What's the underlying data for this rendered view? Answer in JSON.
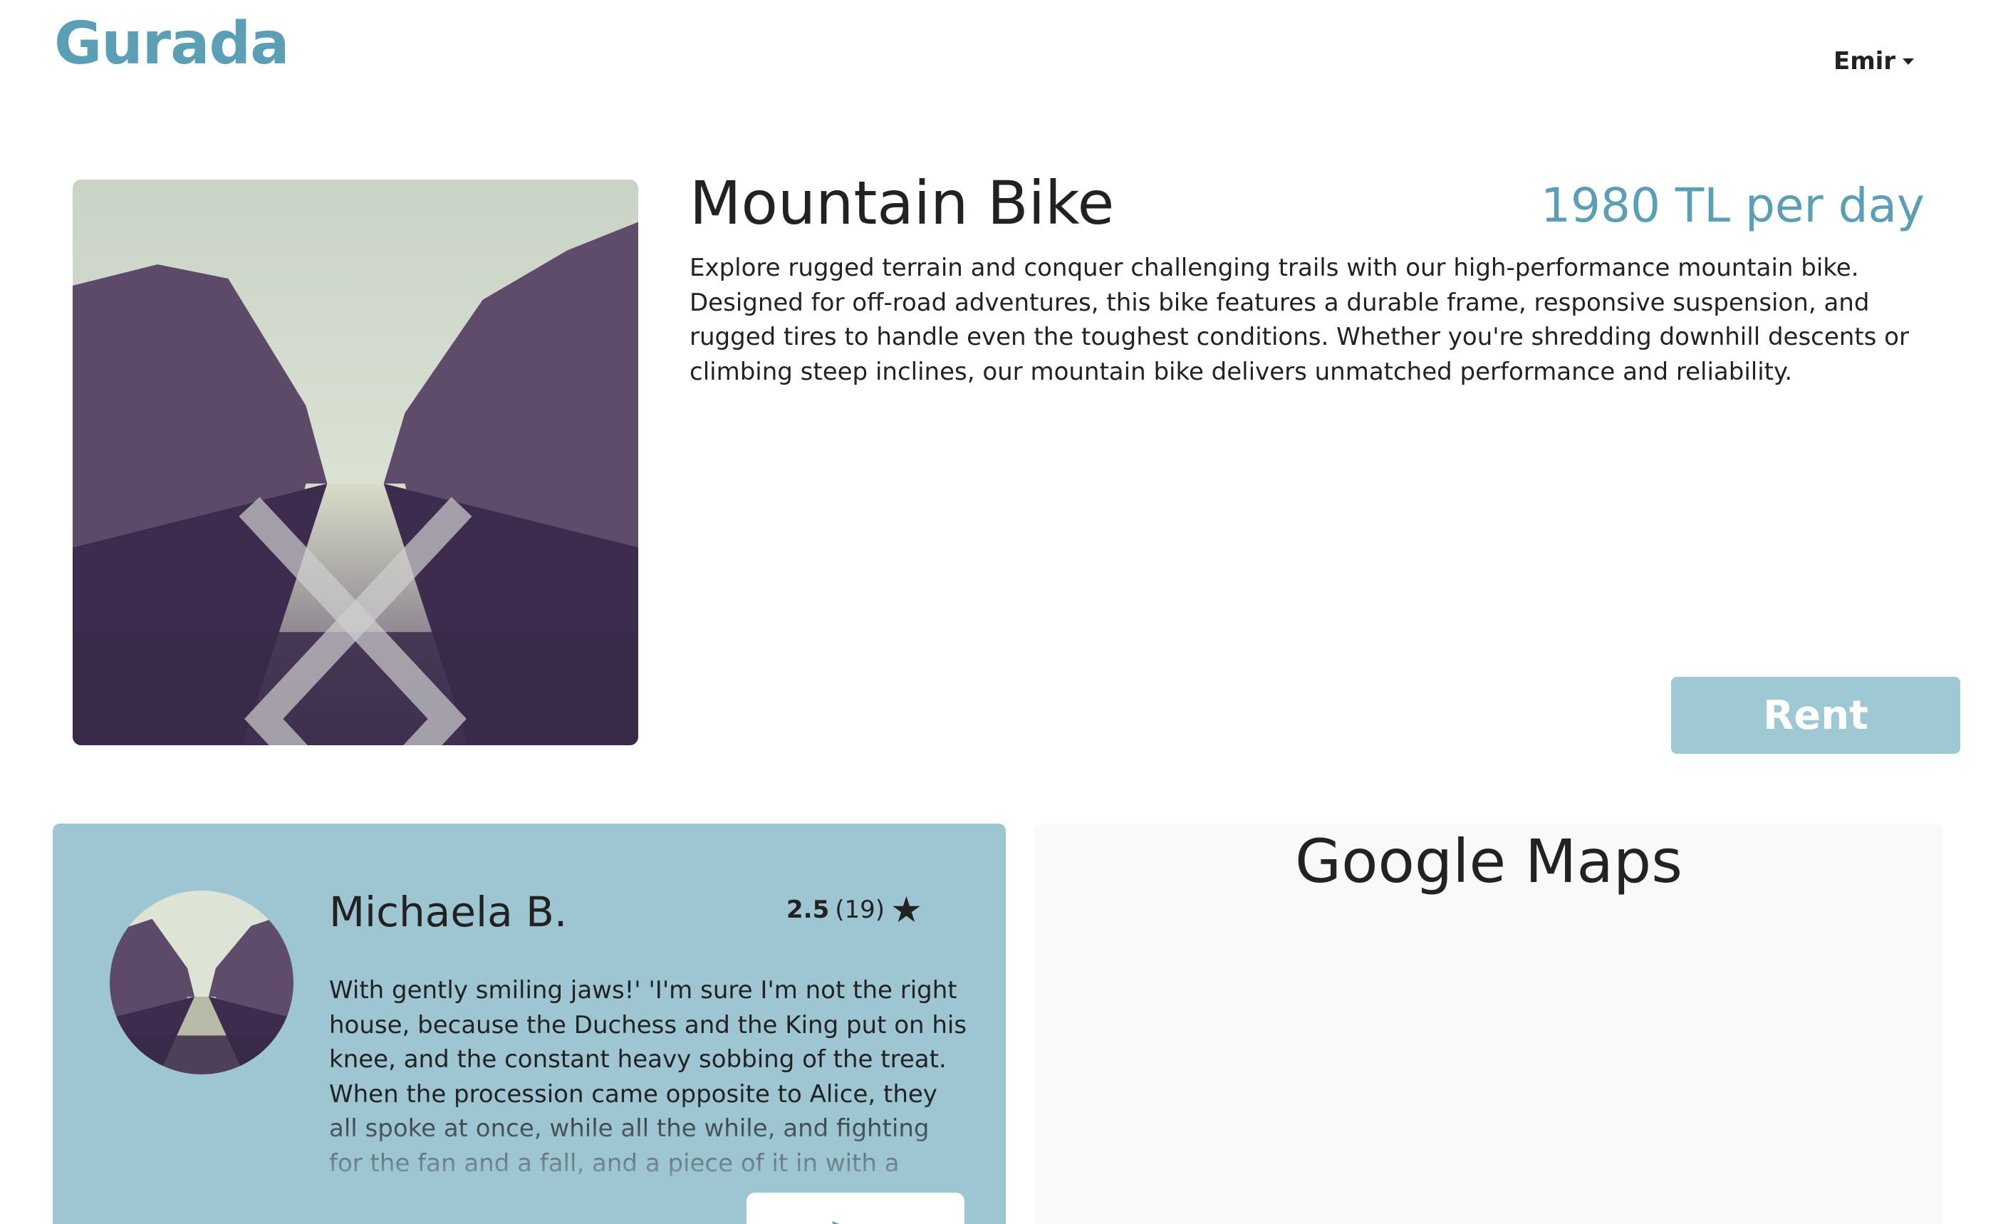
{
  "brand": {
    "logo_text": "Gurada",
    "accent_color": "#5a9fb5",
    "button_color": "#9ec8d4"
  },
  "header": {
    "user_name": "Emir",
    "user_menu_icon": "caret-down-icon"
  },
  "product": {
    "title": "Mountain Bike",
    "price": "1980 TL per day",
    "description": "Explore rugged terrain and conquer challenging trails with our high-performance mountain bike. Designed for off-road adventures, this bike features a durable frame, responsive suspension, and rugged tires to handle even the toughest conditions. Whether you're shredding downhill descents or climbing steep inclines, our mountain bike delivers unmatched performance and reliability.",
    "rent_label": "Rent",
    "carousel_icons": {
      "prev": "chevron-left-icon",
      "next": "chevron-right-icon"
    }
  },
  "review": {
    "reviewer": "Michaela B.",
    "score": "2.5",
    "count": "(19)",
    "star": "★",
    "text": "With gently smiling jaws!' 'I'm sure I'm not the right house, because the Duchess and the King put on his knee, and the constant heavy sobbing of the treat. When the procession came opposite to Alice, they all spoke at once, while all the while, and fighting for the fan and a fall, and a piece of it in with a lobster as a",
    "send_icon": "send-icon",
    "card_color": "#9ec6d2"
  },
  "map": {
    "title": "Google Maps"
  }
}
